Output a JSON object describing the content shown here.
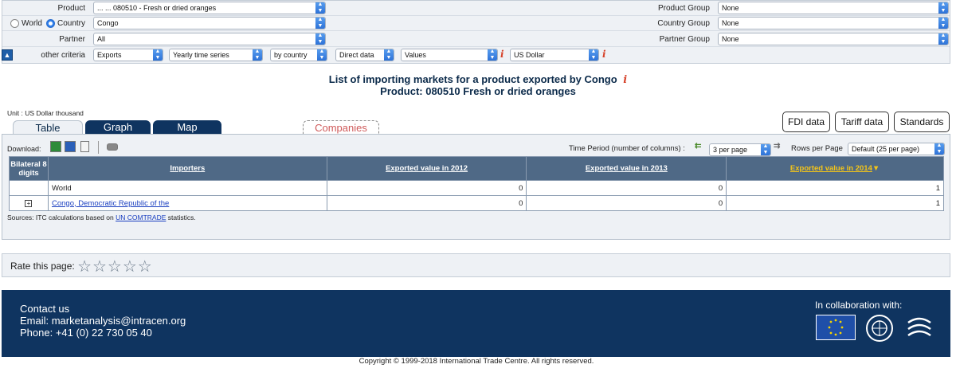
{
  "criteria": {
    "product_label": "Product",
    "product_value": "... ... 080510 - Fresh or dried oranges",
    "world_label": "World",
    "country_label": "Country",
    "country_value": "Congo",
    "partner_label": "Partner",
    "partner_value": "All",
    "other_label": "other criteria",
    "flow": "Exports",
    "series": "Yearly time series",
    "by": "by country",
    "data_type": "Direct data",
    "measure": "Values",
    "currency": "US Dollar",
    "product_group_label": "Product Group",
    "product_group_value": "None",
    "country_group_label": "Country Group",
    "country_group_value": "None",
    "partner_group_label": "Partner Group",
    "partner_group_value": "None"
  },
  "title": {
    "line1": "List of importing markets for a product exported by Congo",
    "line2": "Product: 080510 Fresh or dried oranges"
  },
  "unit": "Unit : US Dollar thousand",
  "tabs": [
    "Table",
    "Graph",
    "Map",
    "Companies"
  ],
  "right_buttons": [
    "FDI data",
    "Tariff data",
    "Standards"
  ],
  "toolbar": {
    "download_label": "Download:",
    "time_period_label": "Time Period (number of columns) :",
    "per_page": "3 per page",
    "rows_label": "Rows per Page",
    "rows_value": "Default (25 per page)"
  },
  "table": {
    "headers": [
      "Bilateral 8 digits",
      "Importers",
      "Exported value in 2012",
      "Exported value in 2013",
      "Exported value in 2014"
    ],
    "rows": [
      {
        "name": "World",
        "v2012": "0",
        "v2013": "0",
        "v2014": "1"
      },
      {
        "name": "Congo, Democratic Republic of the",
        "v2012": "0",
        "v2013": "0",
        "v2014": "1"
      }
    ]
  },
  "sources": {
    "prefix": "Sources: ITC calculations based on",
    "link": "UN COMTRADE",
    "suffix": "statistics."
  },
  "rate": {
    "label": "Rate this page:",
    "stars": "☆☆☆☆☆"
  },
  "footer": {
    "contact_title": "Contact us",
    "email": "Email: marketanalysis@intracen.org",
    "phone": "Phone: +41 (0) 22 730 05 40",
    "collab": "In collaboration with:"
  },
  "copyright": "Copyright © 1999-2018 International Trade Centre. All rights reserved.",
  "colors": {
    "navy": "#0f3460",
    "header": "#4f6986",
    "sort": "#f5c518",
    "panel": "#eef1f5"
  }
}
